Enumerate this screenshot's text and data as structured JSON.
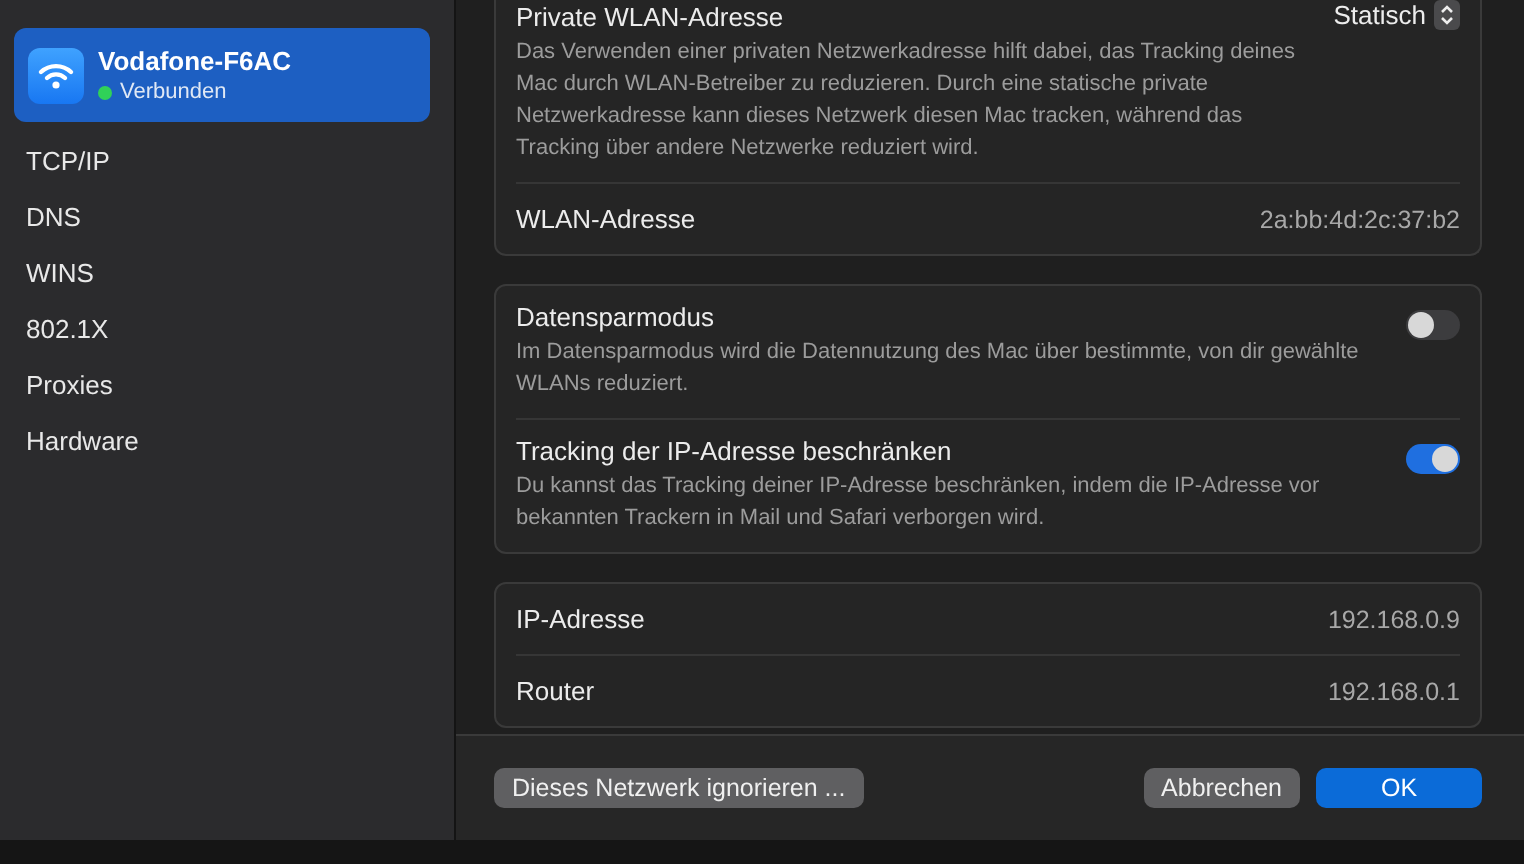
{
  "sidebar": {
    "network": {
      "name": "Vodafone-F6AC",
      "status": "Verbunden",
      "color": "#30d158",
      "selected": true
    },
    "items": [
      {
        "label": "TCP/IP",
        "selected": false
      },
      {
        "label": "DNS",
        "selected": false
      },
      {
        "label": "WINS",
        "selected": false
      },
      {
        "label": "802.1X",
        "selected": false
      },
      {
        "label": "Proxies",
        "selected": false
      },
      {
        "label": "Hardware",
        "selected": false
      }
    ]
  },
  "sections": [
    {
      "rows": [
        {
          "kind": "popup",
          "title": "Private WLAN-Adresse",
          "description": "Das Verwenden einer privaten Netzwerkadresse hilft dabei, das Tracking deines Mac durch WLAN-Betreiber zu reduzieren. Durch eine statische private Netzwerkadresse kann dieses Netzwerk diesen Mac tracken, während das Tracking über andere Netzwerke reduziert wird.",
          "value": "Statisch"
        },
        {
          "kind": "info",
          "title": "WLAN-Adresse",
          "value": "2a:bb:4d:2c:37:b2"
        }
      ]
    },
    {
      "rows": [
        {
          "kind": "toggle",
          "title": "Datensparmodus",
          "description": "Im Datensparmodus wird die Datennutzung des Mac über bestimmte, von dir gewählte WLANs reduziert.",
          "on": false
        },
        {
          "kind": "toggle",
          "title": "Tracking der IP-Adresse beschränken",
          "description": "Du kannst das Tracking deiner IP-Adresse beschränken, indem die IP-Adresse vor bekannten Trackern in Mail und Safari verborgen wird.",
          "on": true
        }
      ]
    },
    {
      "rows": [
        {
          "kind": "info",
          "title": "IP-Adresse",
          "value": "192.168.0.9"
        },
        {
          "kind": "info",
          "title": "Router",
          "value": "192.168.0.1"
        }
      ]
    }
  ],
  "footer": {
    "buttons": [
      {
        "label": "Dieses Netzwerk ignorieren ...",
        "kind": "secondary"
      },
      {
        "label": "Abbrechen",
        "kind": "secondary"
      },
      {
        "label": "OK",
        "kind": "primary"
      }
    ]
  }
}
